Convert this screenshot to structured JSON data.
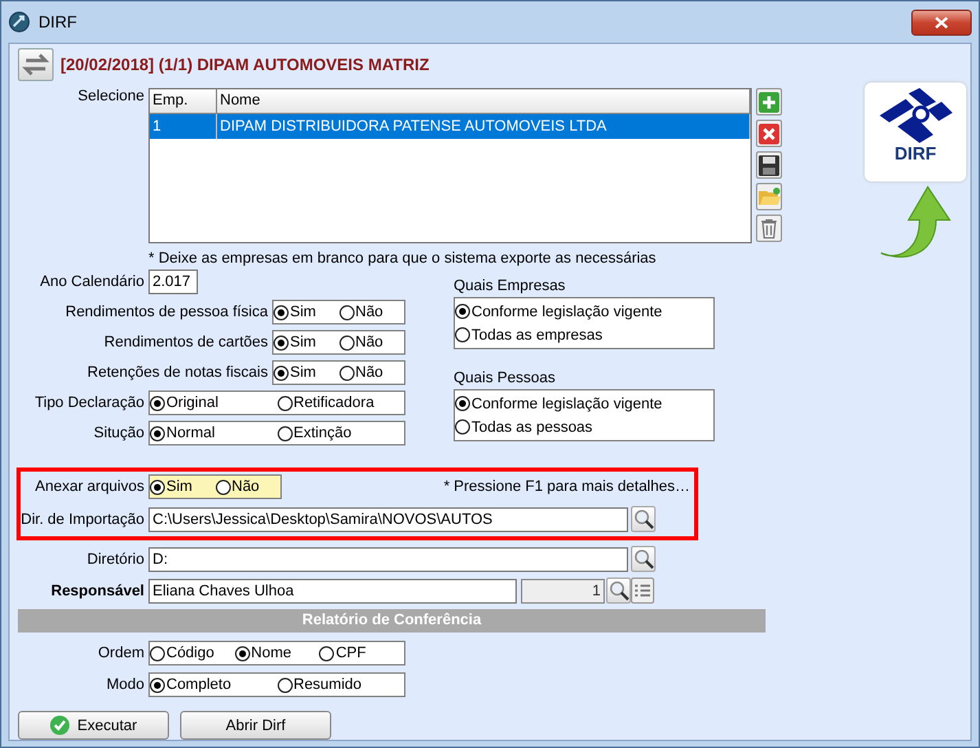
{
  "window": {
    "title": "DIRF"
  },
  "header": {
    "title": "[20/02/2018] (1/1) DIPAM AUTOMOVEIS MATRIZ"
  },
  "companies": {
    "label": "Selecione",
    "columns": [
      "Emp.",
      "Nome"
    ],
    "rows": [
      {
        "cells": [
          "1",
          "DIPAM DISTRIBUIDORA PATENSE AUTOMOVEIS LTDA"
        ],
        "selected": true
      }
    ]
  },
  "logo": {
    "text": "DIRF"
  },
  "companies_note": "* Deixe as empresas em branco para que o sistema exporte as necessárias",
  "ano_calendario": {
    "label": "Ano Calendário",
    "value": "2.017"
  },
  "options": [
    {
      "label": "Rendimentos de pessoa física",
      "choices": [
        {
          "label": "Sim",
          "selected": true
        },
        {
          "label": "Não",
          "selected": false
        }
      ]
    },
    {
      "label": "Rendimentos de cartões",
      "choices": [
        {
          "label": "Sim",
          "selected": true
        },
        {
          "label": "Não",
          "selected": false
        }
      ]
    },
    {
      "label": "Retenções de notas fiscais",
      "choices": [
        {
          "label": "Sim",
          "selected": true
        },
        {
          "label": "Não",
          "selected": false
        }
      ]
    },
    {
      "label": "Tipo Declaração",
      "choices": [
        {
          "label": "Original",
          "selected": true
        },
        {
          "label": "Retificadora",
          "selected": false
        }
      ]
    },
    {
      "label": "Situção",
      "choices": [
        {
          "label": "Normal",
          "selected": true
        },
        {
          "label": "Extinção",
          "selected": false
        }
      ]
    }
  ],
  "groups": [
    {
      "title": "Quais Empresas",
      "choices": [
        {
          "label": "Conforme legislação vigente",
          "selected": true
        },
        {
          "label": "Todas as empresas",
          "selected": false
        }
      ]
    },
    {
      "title": "Quais Pessoas",
      "choices": [
        {
          "label": "Conforme legislação vigente",
          "selected": true
        },
        {
          "label": "Todas as pessoas",
          "selected": false
        }
      ]
    }
  ],
  "anexar": {
    "label": "Anexar arquivos",
    "choices": [
      {
        "label": "Sim",
        "selected": true
      },
      {
        "label": "Não",
        "selected": false
      }
    ],
    "note": "* Pressione F1 para mais detalhes…"
  },
  "fields": [
    {
      "label": "Dir. de Importação",
      "value": "C:\\Users\\Jessica\\Desktop\\Samira\\NOVOS\\AUTOS"
    },
    {
      "label": "Diretório",
      "value": "D:"
    }
  ],
  "responsavel": {
    "label": "Responsável",
    "value": "Eliana Chaves Ulhoa",
    "number": "1"
  },
  "section_title": "Relatório de Conferência",
  "report_options": [
    {
      "label": "Ordem",
      "choices": [
        {
          "label": "Código",
          "selected": false
        },
        {
          "label": "Nome",
          "selected": true
        },
        {
          "label": "CPF",
          "selected": false
        }
      ]
    },
    {
      "label": "Modo",
      "choices": [
        {
          "label": "Completo",
          "selected": true
        },
        {
          "label": "Resumido",
          "selected": false
        }
      ]
    }
  ],
  "buttons": [
    {
      "label": "Executar",
      "kind": "run"
    },
    {
      "label": "Abrir Dirf",
      "kind": "plain"
    }
  ]
}
